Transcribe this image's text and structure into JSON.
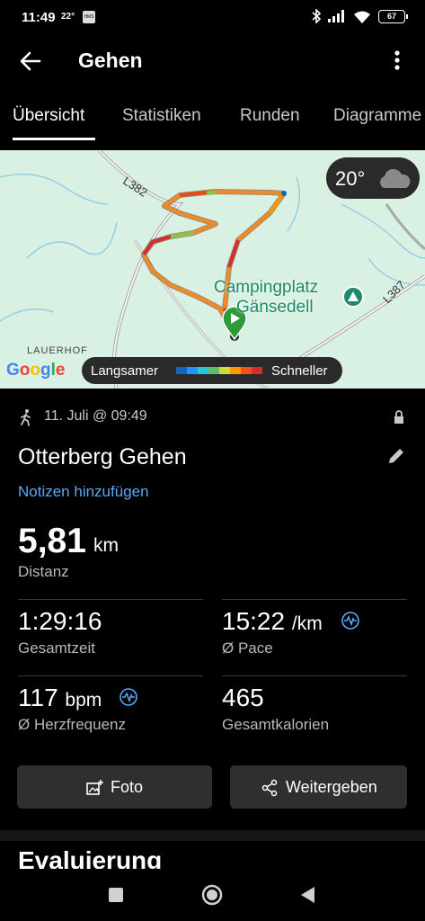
{
  "status_bar": {
    "time": "11:49",
    "temp": "22°",
    "hms": "HMS",
    "battery": "67"
  },
  "app_bar": {
    "title": "Gehen"
  },
  "tabs": [
    {
      "label": "Übersicht"
    },
    {
      "label": "Statistiken"
    },
    {
      "label": "Runden"
    },
    {
      "label": "Diagramme"
    }
  ],
  "map": {
    "weather_temp": "20°",
    "roads": [
      "L382",
      "L387"
    ],
    "place": "Campingplatz",
    "place2": "Gänsedell",
    "locality": "LAUERHOF",
    "logo": "Google",
    "legend_slow": "Langsamer",
    "legend_fast": "Schneller",
    "legend_colors": [
      "#1565c0",
      "#2196f3",
      "#26c6da",
      "#66bb6a",
      "#cddc39",
      "#ff9800",
      "#f4511e",
      "#d32f2f"
    ]
  },
  "activity": {
    "date": "11. Juli @ 09:49",
    "name": "Otterberg Gehen",
    "notes_link": "Notizen hinzufügen"
  },
  "stats": {
    "distance": {
      "value": "5,81",
      "unit": "km",
      "label": "Distanz"
    },
    "total_time": {
      "value": "1:29:16",
      "label": "Gesamtzeit"
    },
    "pace": {
      "value": "15:22",
      "unit": "/km",
      "label": "Ø Pace"
    },
    "heart_rate": {
      "value": "117",
      "unit": "bpm",
      "label": "Ø Herzfrequenz"
    },
    "calories": {
      "value": "465",
      "label": "Gesamtkalorien"
    }
  },
  "buttons": {
    "photo": "Foto",
    "share": "Weitergeben"
  },
  "section": {
    "evaluation": "Evaluierung"
  },
  "colors": {
    "accent_blue": "#5aa9f5",
    "map_bg": "#d9f1e3",
    "camp_green": "#1e8a6a"
  }
}
